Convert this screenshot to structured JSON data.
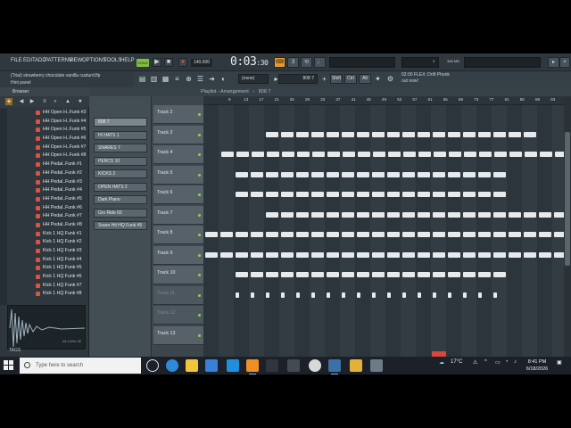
{
  "menu": [
    "FILE",
    "EDIT",
    "ADD",
    "PATTERNS",
    "VIEW",
    "OPTIONS",
    "TOOLS",
    "HELP"
  ],
  "transport": {
    "pattern_song": "SONG",
    "tempo": "140.000",
    "time": "0:03",
    "time_sub": ":30",
    "cpu": "3",
    "mem": "358 MB"
  },
  "hint": {
    "line1": "(Trial) strawberry chocolate vanilla custurd.flp",
    "line2": "Hint panel"
  },
  "toolbar2": {
    "snap": "(none)",
    "selected_pattern": "808 7",
    "mod_buttons": [
      "Shift",
      "Ctrl",
      "Alt"
    ],
    "plugin_line1": "02:00  FLEX: Drift Phonk",
    "plugin_line2": "out now!"
  },
  "browser": {
    "title": "Browser",
    "files": [
      "HH Open H..Funk #3",
      "HH Open H..Funk #4",
      "HH Open H..Funk #5",
      "HH Open H..Funk #6",
      "HH Open H..Funk #7",
      "HH Open H..Funk #8",
      "HH Pedal..Funk #1",
      "HH Pedal..Funk #2",
      "HH Pedal..Funk #3",
      "HH Pedal..Funk #4",
      "HH Pedal..Funk #5",
      "HH Pedal..Funk #6",
      "HH Pedal..Funk #7",
      "HH Pedal..Funk #8",
      "Kick 1 HQ Funk #1",
      "Kick 1 HQ Funk #2",
      "Kick 1 HQ Funk #3",
      "Kick 1 HQ Funk #4",
      "Kick 1 HQ Funk #5",
      "Kick 1 HQ Funk #6",
      "Kick 1 HQ Funk #7",
      "Kick 1 HQ Funk #8"
    ],
    "wave_info": "44.1 kHz 32",
    "tags": "TAGS"
  },
  "playlist": {
    "title": "Playlist - Arrangement",
    "breadcrumb": "808 7",
    "patterns": [
      "808 7",
      "HI HATS 1",
      "SNARES 7",
      "PERCS 10",
      "KICKS 2",
      "OPEN HATS 2",
      "Dark Piano",
      "Grv Ride 02",
      "Snare Hit HQ Funk #5"
    ],
    "tracks": [
      "Track 2",
      "Track 3",
      "Track 4",
      "Track 5",
      "Track 6",
      "Track 7",
      "Track 8",
      "Track 9",
      "Track 10",
      "Track 11",
      "Track 12",
      "Track 13"
    ],
    "bars": [
      "9",
      "13",
      "17",
      "21",
      "25",
      "29",
      "33",
      "37",
      "41",
      "45",
      "49",
      "53",
      "57",
      "61",
      "65",
      "69",
      "73",
      "77",
      "81",
      "85",
      "89",
      "93"
    ]
  },
  "taskbar": {
    "search_placeholder": "Type here to search",
    "weather": "17°C",
    "time": "8:41 PM",
    "date": "6/18/2026"
  }
}
